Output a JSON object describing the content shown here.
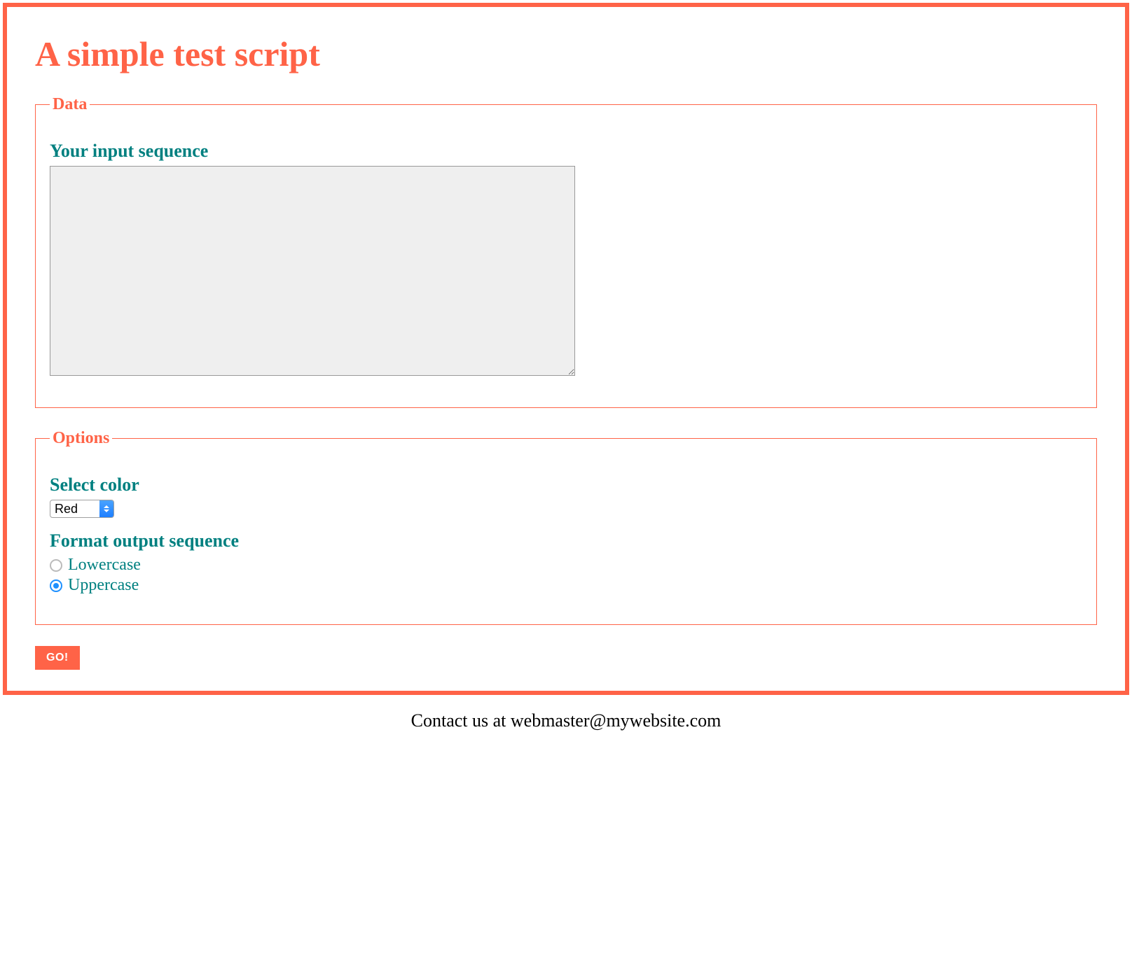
{
  "page": {
    "title": "A simple test script"
  },
  "data_section": {
    "legend": "Data",
    "input_sequence_label": "Your input sequence",
    "input_sequence_value": ""
  },
  "options_section": {
    "legend": "Options",
    "select_color_label": "Select color",
    "select_color_value": "Red",
    "format_label": "Format output sequence",
    "radios": {
      "lowercase": {
        "label": "Lowercase",
        "selected": false
      },
      "uppercase": {
        "label": "Uppercase",
        "selected": true
      }
    }
  },
  "actions": {
    "go_label": "GO!"
  },
  "footer": {
    "contact_text": "Contact us at webmaster@mywebsite.com"
  },
  "colors": {
    "accent": "#ff6347",
    "teal": "#008080"
  }
}
